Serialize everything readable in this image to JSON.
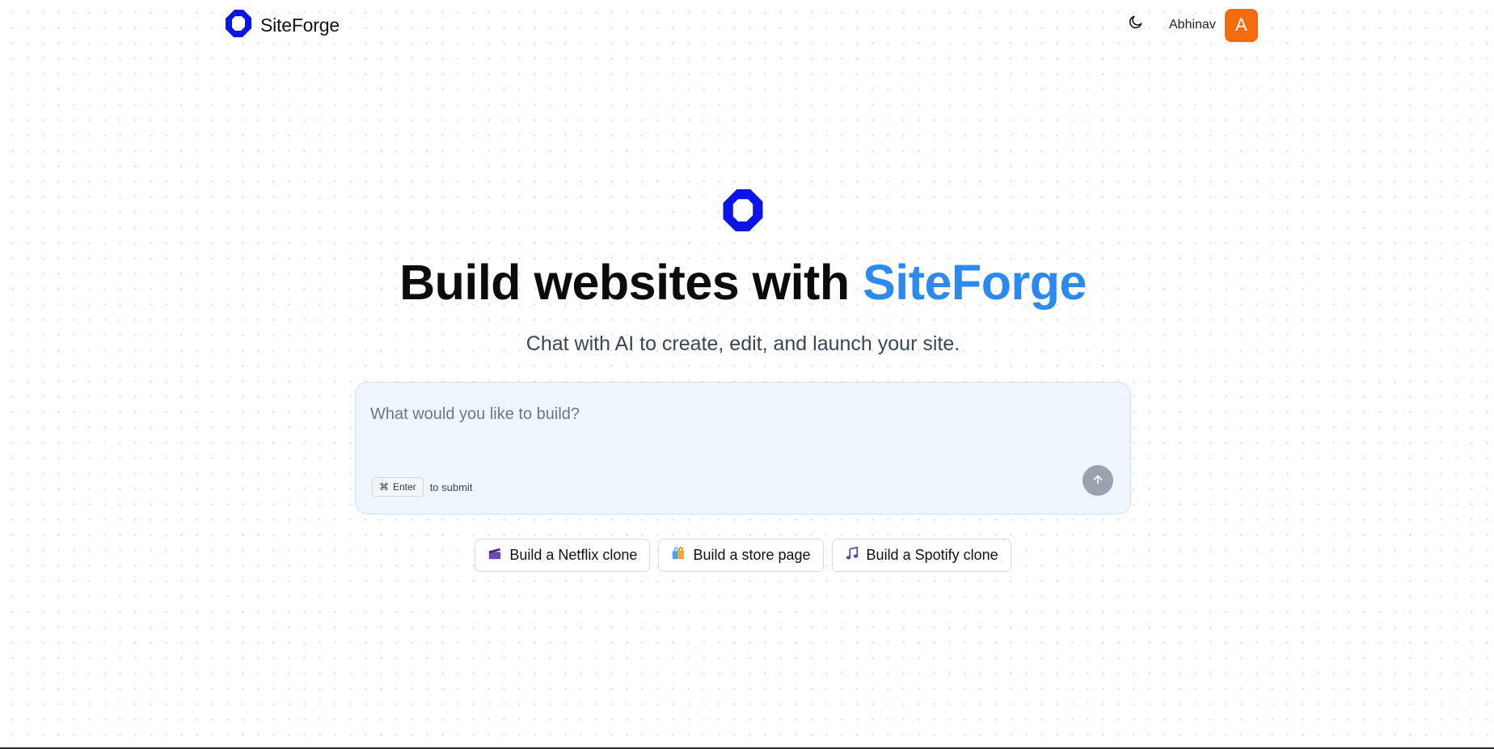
{
  "header": {
    "brand_name": "SiteForge",
    "user_name": "Abhinav",
    "avatar_initial": "A",
    "theme_icon": "moon-icon"
  },
  "hero": {
    "title_prefix": "Build websites with",
    "title_accent": "SiteForge",
    "subtitle": "Chat with AI to create, edit, and launch your site."
  },
  "prompt": {
    "placeholder": "What would you like to build?",
    "value": "",
    "shortcut_symbol": "⌘",
    "shortcut_key": "Enter",
    "shortcut_hint": "to submit",
    "send_icon": "arrow-up-icon"
  },
  "suggestions": [
    {
      "label": "Build a Netflix clone",
      "icon": "clapperboard-icon"
    },
    {
      "label": "Build a store page",
      "icon": "shopping-bag-icon"
    },
    {
      "label": "Build a Spotify clone",
      "icon": "music-note-icon"
    }
  ],
  "colors": {
    "brand_logo": "#0a14e6",
    "accent": "#2b8af0",
    "avatar": "#f26b0f",
    "prompt_bg": "#eff6fd",
    "send_button": "#9aa3ad"
  }
}
